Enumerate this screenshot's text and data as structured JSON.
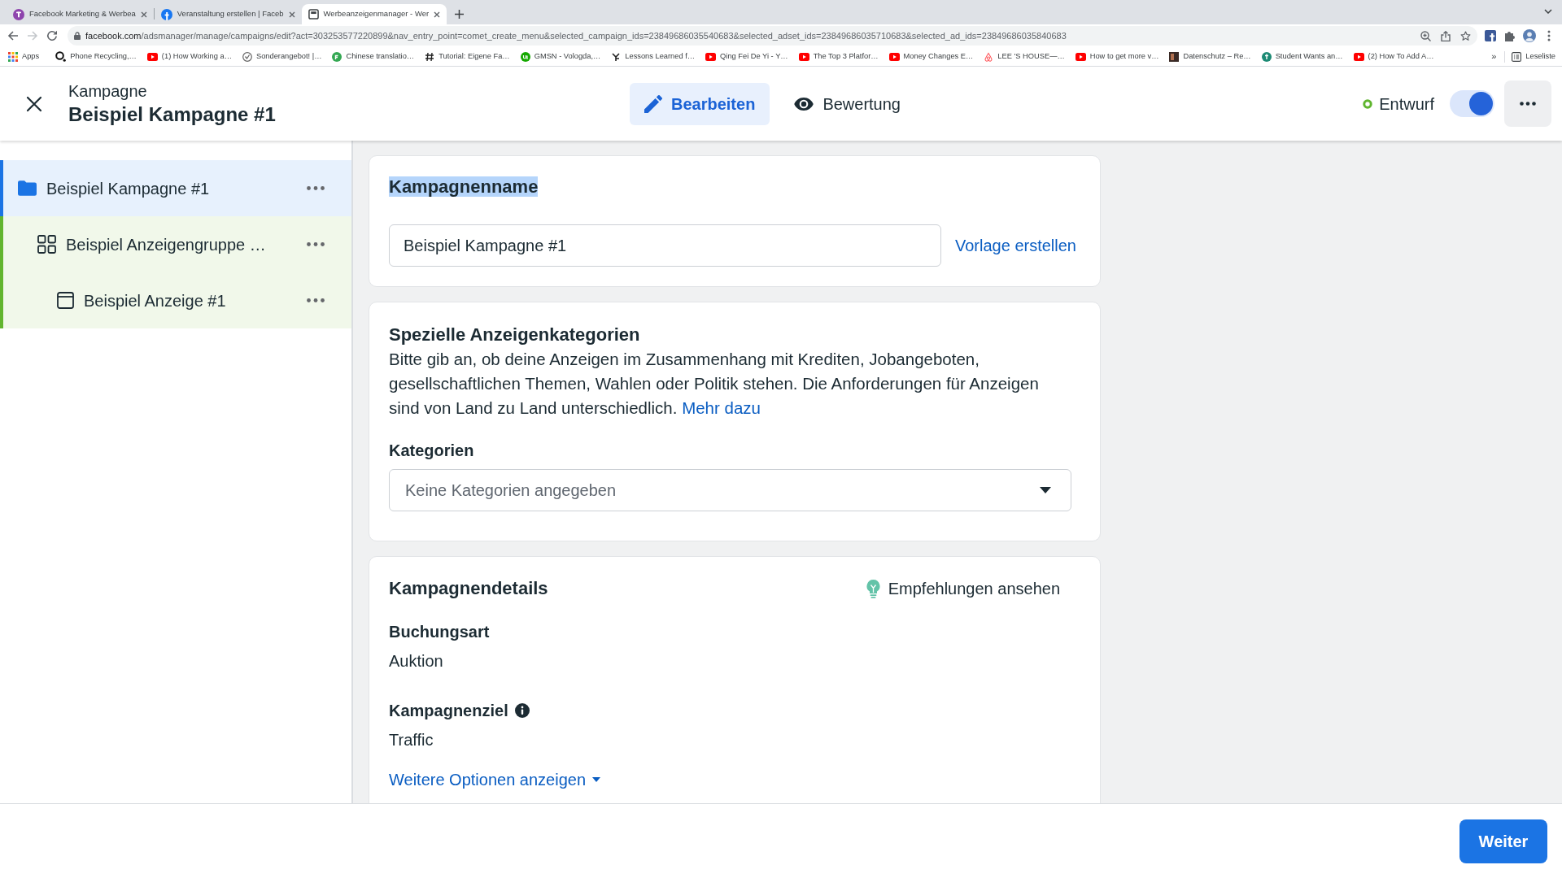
{
  "browser": {
    "tabs": [
      {
        "title": "Facebook Marketing & Werbea",
        "selected": false
      },
      {
        "title": "Veranstaltung erstellen | Faceb",
        "selected": false
      },
      {
        "title": "Werbeanzeigenmanager - Wer",
        "selected": true
      }
    ],
    "forward_disabled": true,
    "address": {
      "host": "facebook.com",
      "path": "/adsmanager/manage/campaigns/edit?act=303253577220899&nav_entry_point=comet_create_menu&selected_campaign_ids=23849686035540683&selected_adset_ids=23849686035710683&selected_ad_ids=23849686035840683"
    },
    "bookmarks": [
      "Apps",
      "Phone Recycling,…",
      "(1) How Working a…",
      "Sonderangebot! |…",
      "Chinese translatio…",
      "Tutorial: Eigene Fa…",
      "GMSN - Vologda,…",
      "Lessons Learned f…",
      "Qing Fei De Yi - Y…",
      "The Top 3 Platfor…",
      "Money Changes E…",
      "LEE 'S HOUSE—…",
      "How to get more v…",
      "Datenschutz – Re…",
      "Student Wants an…",
      "(2) How To Add A…"
    ],
    "bookmarks_overflow": "»",
    "reading_list": "Leseliste"
  },
  "header": {
    "subtitle": "Kampagne",
    "title": "Beispiel Kampagne #1",
    "tabs": [
      {
        "label": "Bearbeiten",
        "selected": true
      },
      {
        "label": "Bewertung",
        "selected": false
      }
    ],
    "status": "Entwurf",
    "toggle_on": true
  },
  "sidebar": {
    "items": [
      {
        "label": "Beispiel Kampagne #1",
        "kind": "campaign",
        "selected": true,
        "children": [
          {
            "label": "Beispiel Anzeigengruppe …",
            "kind": "ad_set",
            "selected": false,
            "children": [
              {
                "label": "Beispiel Anzeige #1",
                "kind": "ad",
                "selected": false
              }
            ]
          }
        ]
      }
    ]
  },
  "campaign_name": {
    "title": "Kampagnenname",
    "title_highlighted": true,
    "value": "Beispiel Kampagne #1",
    "link": "Vorlage erstellen"
  },
  "special_categories": {
    "title": "Spezielle Anzeigenkategorien",
    "description": "Bitte gib an, ob deine Anzeigen im Zusammenhang mit Krediten, Jobangeboten, gesellschaftlichen Themen, Wahlen oder Politik stehen. Die Anforderungen für Anzeigen sind von Land zu Land unterschiedlich.",
    "link": "Mehr dazu",
    "field_label": "Kategorien",
    "placeholder": "Keine Kategorien angegeben"
  },
  "campaign_details": {
    "title": "Kampagnendetails",
    "recommendations": "Empfehlungen ansehen",
    "fields": [
      {
        "label": "Buchungsart",
        "value": "Auktion",
        "info": false
      },
      {
        "label": "Kampagnenziel",
        "value": "Traffic",
        "info": true
      }
    ],
    "more_link": "Weitere Optionen anzeigen"
  },
  "footer": {
    "next_button": "Weiter"
  }
}
